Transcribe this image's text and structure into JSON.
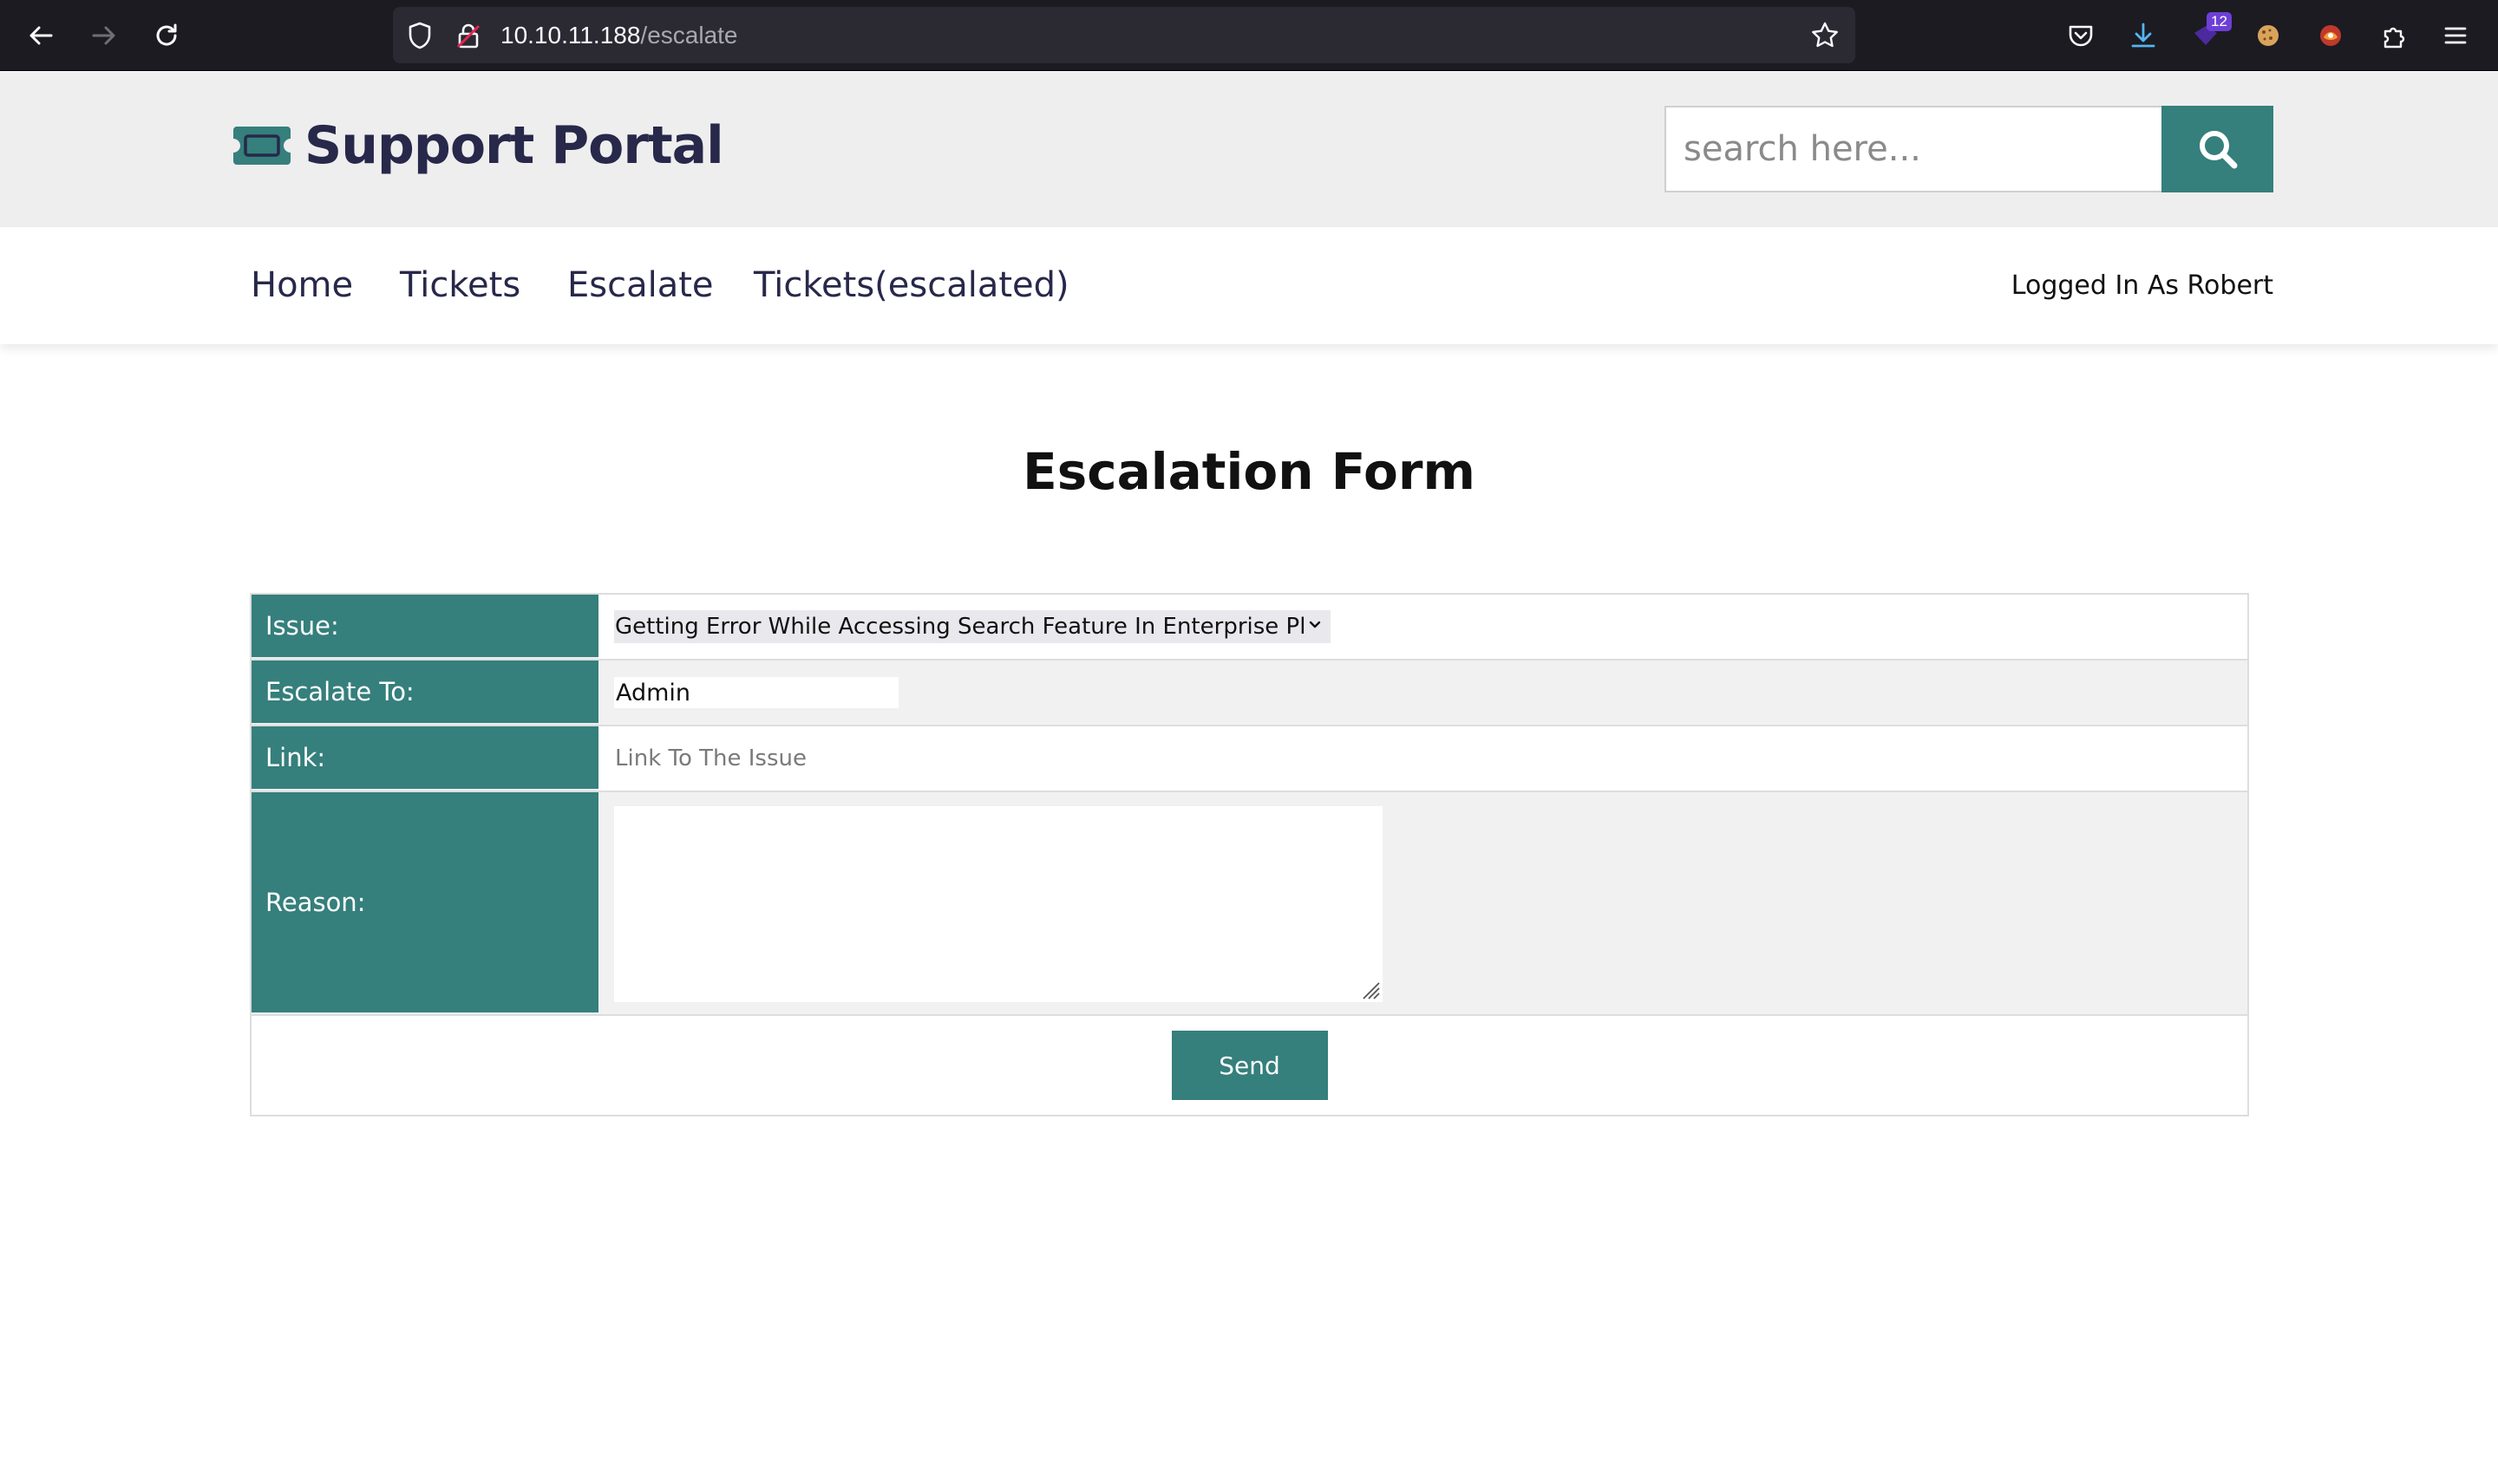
{
  "browser": {
    "url_host": "10.10.11.188",
    "url_path": "/escalate",
    "extension_badge": "12"
  },
  "header": {
    "brand": "Support Portal",
    "search_placeholder": "search here..."
  },
  "nav": {
    "items": [
      "Home",
      "Tickets",
      "Escalate",
      "Tickets(escalated)"
    ],
    "user_status": "Logged In As Robert"
  },
  "main": {
    "title": "Escalation Form",
    "form": {
      "issue_label": "Issue:",
      "issue_value": "Getting Error While Accessing Search Feature In Enterprise Platform",
      "escalate_label": "Escalate To:",
      "escalate_value": "Admin",
      "link_label": "Link:",
      "link_placeholder": "Link To The Issue",
      "reason_label": "Reason:",
      "submit_label": "Send"
    }
  },
  "colors": {
    "accent": "#357f7c",
    "brand_text": "#27284a",
    "header_bg": "#eeeeee",
    "chrome_bg": "#1c1b22"
  }
}
